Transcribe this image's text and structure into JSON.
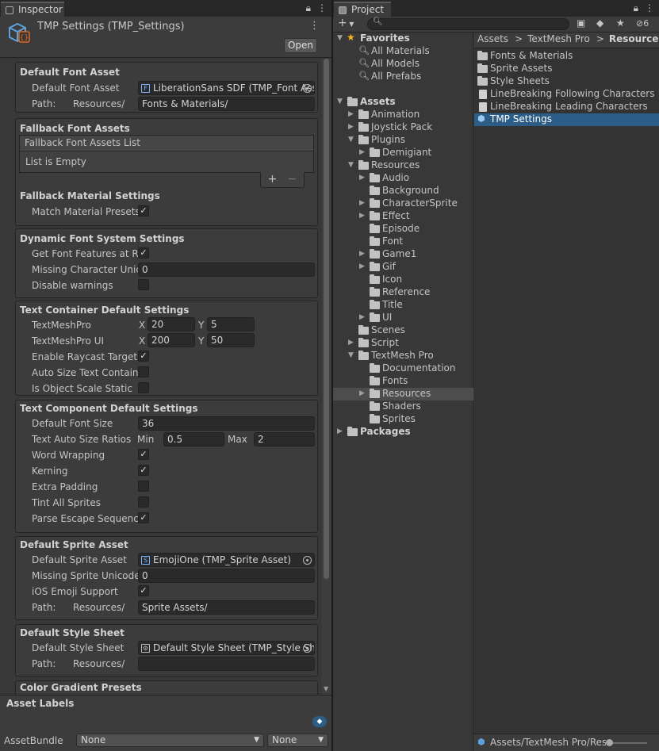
{
  "inspector": {
    "tab_label": "Inspector",
    "title": "TMP Settings (TMP_Settings)",
    "open_label": "Open",
    "default_font_asset": {
      "header": "Default Font Asset",
      "font_label": "Default Font Asset",
      "font_value": "LiberationSans SDF (TMP_Font Asset)",
      "path_label": "Path:",
      "path_prefix": "Resources/",
      "path_value": "Fonts & Materials/"
    },
    "fallback": {
      "header": "Fallback Font Assets",
      "list_header": "Fallback Font Assets List",
      "list_empty": "List is Empty",
      "plus": "+",
      "minus": "−",
      "material_header": "Fallback Material Settings",
      "match_label": "Match Material Presets",
      "match_checked": true
    },
    "dynamic": {
      "header": "Dynamic Font System Settings",
      "get_features_label": "Get Font Features at Runtime",
      "get_features_checked": true,
      "missing_char_label": "Missing Character Unicode",
      "missing_char_value": "0",
      "disable_warnings_label": "Disable warnings",
      "disable_warnings_checked": false
    },
    "text_container": {
      "header": "Text Container Default Settings",
      "tmp_label": "TextMeshPro",
      "tmp_x": "20",
      "tmp_y": "5",
      "tmpui_label": "TextMeshPro UI",
      "tmpui_x": "200",
      "tmpui_y": "50",
      "x_label": "X",
      "y_label": "Y",
      "raycast_label": "Enable Raycast Target",
      "raycast_checked": true,
      "autosize_label": "Auto Size Text Container",
      "autosize_checked": false,
      "objscale_label": "Is Object Scale Static",
      "objscale_checked": false
    },
    "text_component": {
      "header": "Text Component Default Settings",
      "font_size_label": "Default Font Size",
      "font_size_value": "36",
      "auto_size_label": "Text Auto Size Ratios",
      "min_label": "Min",
      "min_value": "0.5",
      "max_label": "Max",
      "max_value": "2",
      "word_wrap_label": "Word Wrapping",
      "word_wrap_checked": true,
      "kerning_label": "Kerning",
      "kerning_checked": true,
      "extra_padding_label": "Extra Padding",
      "extra_padding_checked": false,
      "tint_label": "Tint All Sprites",
      "tint_checked": false,
      "escape_label": "Parse Escape Sequences",
      "escape_checked": true
    },
    "sprite": {
      "header": "Default Sprite Asset",
      "asset_label": "Default Sprite Asset",
      "asset_value": "EmojiOne (TMP_Sprite Asset)",
      "missing_label": "Missing Sprite Unicode",
      "missing_value": "0",
      "ios_label": "iOS Emoji Support",
      "ios_checked": true,
      "path_label": "Path:",
      "path_prefix": "Resources/",
      "path_value": "Sprite Assets/"
    },
    "style": {
      "header": "Default Style Sheet",
      "sheet_label": "Default Style Sheet",
      "sheet_value": "Default Style Sheet (TMP_Style Sheet)",
      "path_label": "Path:",
      "path_prefix": "Resources/",
      "path_value": ""
    },
    "gradient_header": "Color Gradient Presets",
    "asset_labels": "Asset Labels",
    "assetbundle_label": "AssetBundle",
    "assetbundle_value": "None",
    "variant_value": "None"
  },
  "project": {
    "tab_label": "Project",
    "add_label": "+",
    "hidden_count": "6",
    "favorites": {
      "label": "Favorites",
      "items": [
        "All Materials",
        "All Models",
        "All Prefabs"
      ]
    },
    "tree": [
      {
        "label": "Assets",
        "depth": 0,
        "arrow": "down",
        "bold": true
      },
      {
        "label": "Animation",
        "depth": 1,
        "arrow": "right"
      },
      {
        "label": "Joystick Pack",
        "depth": 1,
        "arrow": "right"
      },
      {
        "label": "Plugins",
        "depth": 1,
        "arrow": "down"
      },
      {
        "label": "Demigiant",
        "depth": 2,
        "arrow": "right"
      },
      {
        "label": "Resources",
        "depth": 1,
        "arrow": "down"
      },
      {
        "label": "Audio",
        "depth": 2,
        "arrow": "right"
      },
      {
        "label": "Background",
        "depth": 2,
        "arrow": ""
      },
      {
        "label": "CharacterSprite",
        "depth": 2,
        "arrow": "right"
      },
      {
        "label": "Effect",
        "depth": 2,
        "arrow": "right"
      },
      {
        "label": "Episode",
        "depth": 2,
        "arrow": ""
      },
      {
        "label": "Font",
        "depth": 2,
        "arrow": ""
      },
      {
        "label": "Game1",
        "depth": 2,
        "arrow": "right"
      },
      {
        "label": "Gif",
        "depth": 2,
        "arrow": "right"
      },
      {
        "label": "Icon",
        "depth": 2,
        "arrow": ""
      },
      {
        "label": "Reference",
        "depth": 2,
        "arrow": ""
      },
      {
        "label": "Title",
        "depth": 2,
        "arrow": ""
      },
      {
        "label": "UI",
        "depth": 2,
        "arrow": "right"
      },
      {
        "label": "Scenes",
        "depth": 1,
        "arrow": ""
      },
      {
        "label": "Script",
        "depth": 1,
        "arrow": "right"
      },
      {
        "label": "TextMesh Pro",
        "depth": 1,
        "arrow": "down"
      },
      {
        "label": "Documentation",
        "depth": 2,
        "arrow": ""
      },
      {
        "label": "Fonts",
        "depth": 2,
        "arrow": ""
      },
      {
        "label": "Resources",
        "depth": 2,
        "arrow": "right",
        "selected": true
      },
      {
        "label": "Shaders",
        "depth": 2,
        "arrow": ""
      },
      {
        "label": "Sprites",
        "depth": 2,
        "arrow": ""
      },
      {
        "label": "Packages",
        "depth": 0,
        "arrow": "right",
        "bold": true
      }
    ],
    "breadcrumb": [
      "Assets",
      "TextMesh Pro",
      "Resources"
    ],
    "breadcrumb_sep": ">",
    "assets": [
      {
        "label": "Fonts & Materials",
        "kind": "folder"
      },
      {
        "label": "Sprite Assets",
        "kind": "folder"
      },
      {
        "label": "Style Sheets",
        "kind": "folder"
      },
      {
        "label": "LineBreaking Following Characters",
        "kind": "text"
      },
      {
        "label": "LineBreaking Leading Characters",
        "kind": "text"
      },
      {
        "label": "TMP Settings",
        "kind": "settings",
        "selected": true
      }
    ],
    "status_path": "Assets/TextMesh Pro/Resources/TMP Settings.asset"
  },
  "colors": {
    "selection": "#2c5d87",
    "accent_star": "#f2b51a",
    "settings_icon": "#5da1dc"
  }
}
